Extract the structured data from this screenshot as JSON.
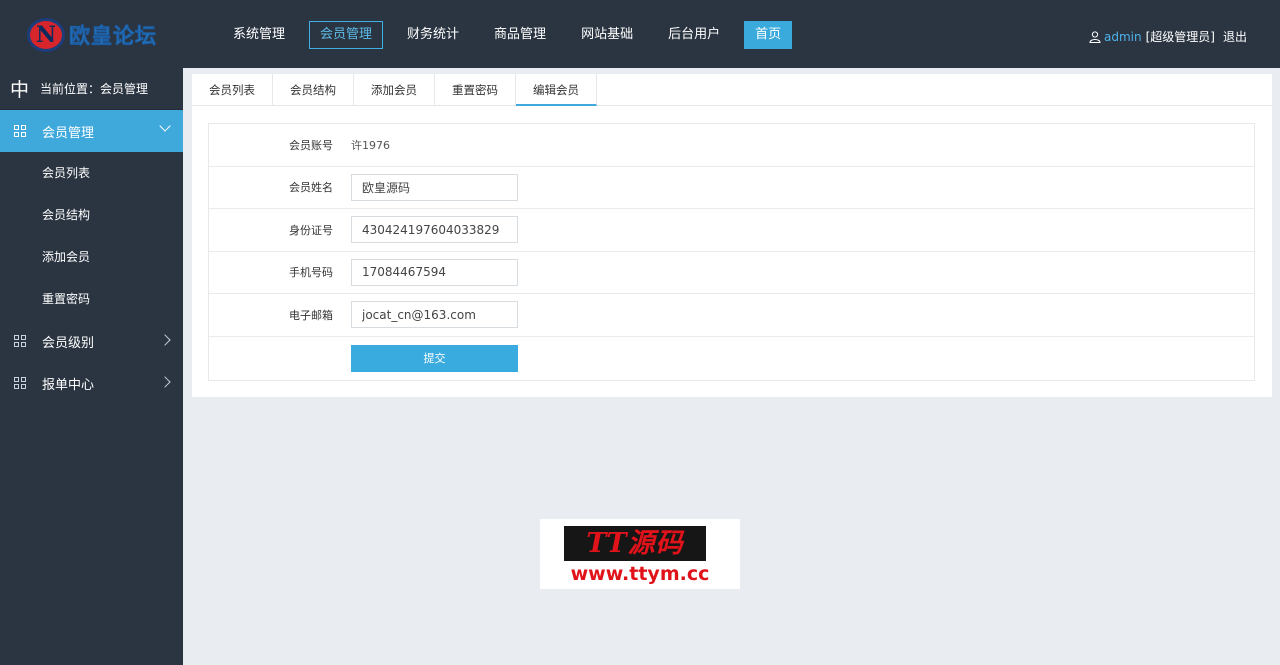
{
  "header": {
    "logo_text": "欧皇论坛",
    "logo_glyph": "N",
    "nav": [
      {
        "label": "系统管理",
        "name": "nav-system",
        "state": "normal"
      },
      {
        "label": "会员管理",
        "name": "nav-members",
        "state": "active"
      },
      {
        "label": "财务统计",
        "name": "nav-finance",
        "state": "normal"
      },
      {
        "label": "商品管理",
        "name": "nav-products",
        "state": "normal"
      },
      {
        "label": "网站基础",
        "name": "nav-site",
        "state": "normal"
      },
      {
        "label": "后台用户",
        "name": "nav-admin-users",
        "state": "normal"
      },
      {
        "label": "首页",
        "name": "nav-home",
        "state": "home"
      }
    ],
    "user": {
      "name": "admin",
      "role": "[超级管理员]",
      "logout": "退出"
    }
  },
  "sidebar": {
    "location_icon": "中",
    "location_text": "当前位置：会员管理",
    "menu_member": "会员管理",
    "sub_items": [
      "会员列表",
      "会员结构",
      "添加会员",
      "重置密码"
    ],
    "menu_level": "会员级别",
    "menu_report": "报单中心"
  },
  "tabs": [
    "会员列表",
    "会员结构",
    "添加会员",
    "重置密码",
    "编辑会员"
  ],
  "form": {
    "account_label": "会员账号",
    "account_value": "许1976",
    "name_label": "会员姓名",
    "name_value": "欧皇源码",
    "id_label": "身份证号",
    "id_value": "430424197604033829",
    "phone_label": "手机号码",
    "phone_value": "17084467594",
    "email_label": "电子邮箱",
    "email_value": "jocat_cn@163.com",
    "submit_label": "提交"
  },
  "watermark": {
    "top": "TT源码",
    "bottom": "www.ttym.cc"
  },
  "colors": {
    "accent": "#40a9dc",
    "dark": "#2b3441",
    "watermark_red": "#e0121a"
  }
}
